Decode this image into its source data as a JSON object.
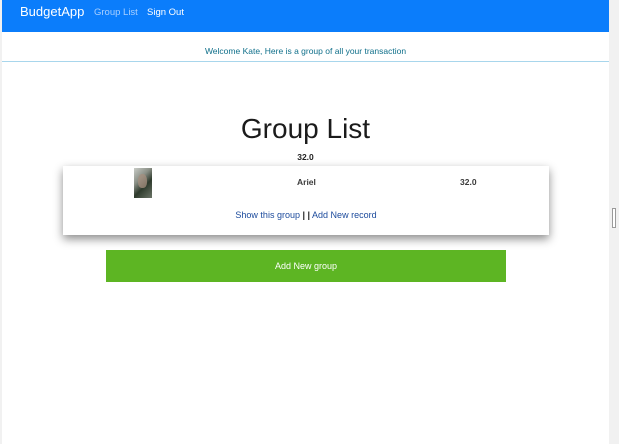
{
  "navbar": {
    "brand": "BudgetApp",
    "links": [
      {
        "label": "Group List"
      },
      {
        "label": "Sign Out"
      }
    ]
  },
  "welcome": {
    "text": "Welcome Kate, Here is a group of all your transaction"
  },
  "main": {
    "title": "Group List",
    "total": "32.0",
    "groups": [
      {
        "name": "Ariel",
        "amount": "32.0",
        "show_label": "Show this group",
        "separator": "| |",
        "add_record_label": "Add New record"
      }
    ],
    "add_group_label": "Add New group"
  },
  "colors": {
    "navbar": "#0b7dfb",
    "accent_button": "#5db523",
    "link": "#1b4a9c"
  }
}
